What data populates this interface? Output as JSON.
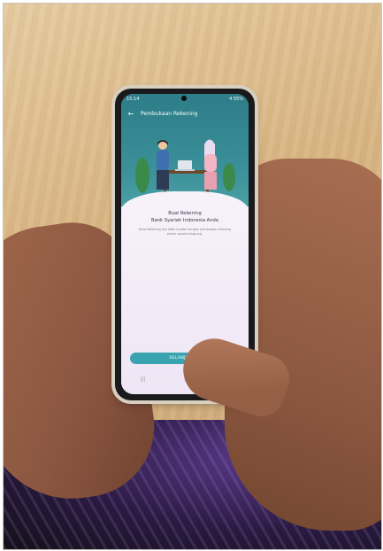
{
  "screen": {
    "status_time": "15:14",
    "status_right": "4 55%",
    "app_bar": {
      "back_icon": "arrow-left-icon",
      "title": "Pembukaan Rekening"
    },
    "heading": "Buat Rekening",
    "subheading": "Bank Syariah Indonesia Anda",
    "description": "Buka Rekening kini lebih mudah dengan pembuatan rekening online secara langsung.",
    "button_label": "SELANJUTNYA",
    "nav": {
      "recent_icon": "|||",
      "home_icon": "○",
      "back_icon": "‹"
    }
  },
  "colors": {
    "accent": "#3aa3b0",
    "header": "#2f7f8a"
  }
}
